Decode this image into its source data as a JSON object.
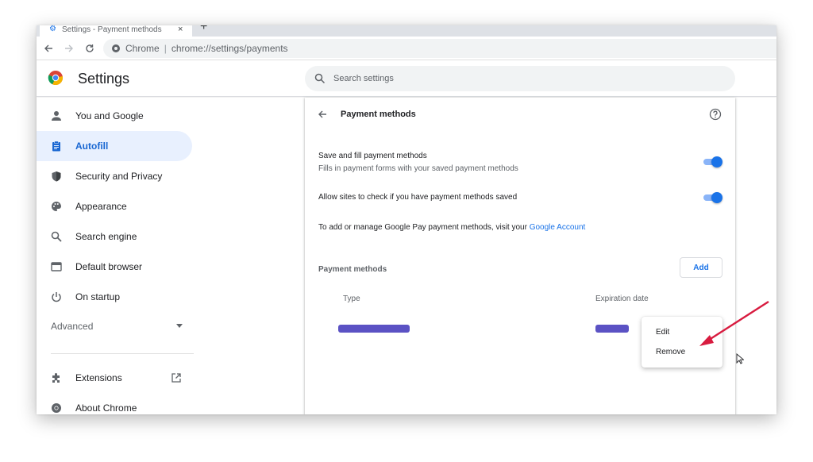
{
  "tab": {
    "title": "Settings - Payment methods",
    "close": "×",
    "new_tab": "+"
  },
  "omnibox": {
    "site_label": "Chrome",
    "separator": "|",
    "url": "chrome://settings/payments"
  },
  "header": {
    "title": "Settings",
    "search_placeholder": "Search settings"
  },
  "sidebar": {
    "items": [
      {
        "label": "You and Google",
        "icon": "person-icon"
      },
      {
        "label": "Autofill",
        "icon": "clipboard-icon",
        "active": true
      },
      {
        "label": "Security and Privacy",
        "icon": "shield-icon"
      },
      {
        "label": "Appearance",
        "icon": "palette-icon"
      },
      {
        "label": "Search engine",
        "icon": "search-icon"
      },
      {
        "label": "Default browser",
        "icon": "browser-icon"
      },
      {
        "label": "On startup",
        "icon": "power-icon"
      }
    ],
    "advanced": "Advanced",
    "extensions": "Extensions",
    "about": "About Chrome"
  },
  "page": {
    "title": "Payment methods",
    "save_fill_title": "Save and fill payment methods",
    "save_fill_sub": "Fills in payment forms with your saved payment methods",
    "save_fill_enabled": true,
    "allow_check_title": "Allow sites to check if you have payment methods saved",
    "allow_check_enabled": true,
    "gpay_text": "To add or manage Google Pay payment methods, visit your ",
    "gpay_link": "Google Account",
    "section_label": "Payment methods",
    "add_button": "Add",
    "col_type": "Type",
    "col_expiration": "Expiration date"
  },
  "menu": {
    "edit": "Edit",
    "remove": "Remove"
  },
  "colors": {
    "accent": "#1a73e8",
    "active_bg": "#e8f0fe",
    "annotation_arrow": "#d81b3f",
    "redaction": "#5b52c4"
  }
}
